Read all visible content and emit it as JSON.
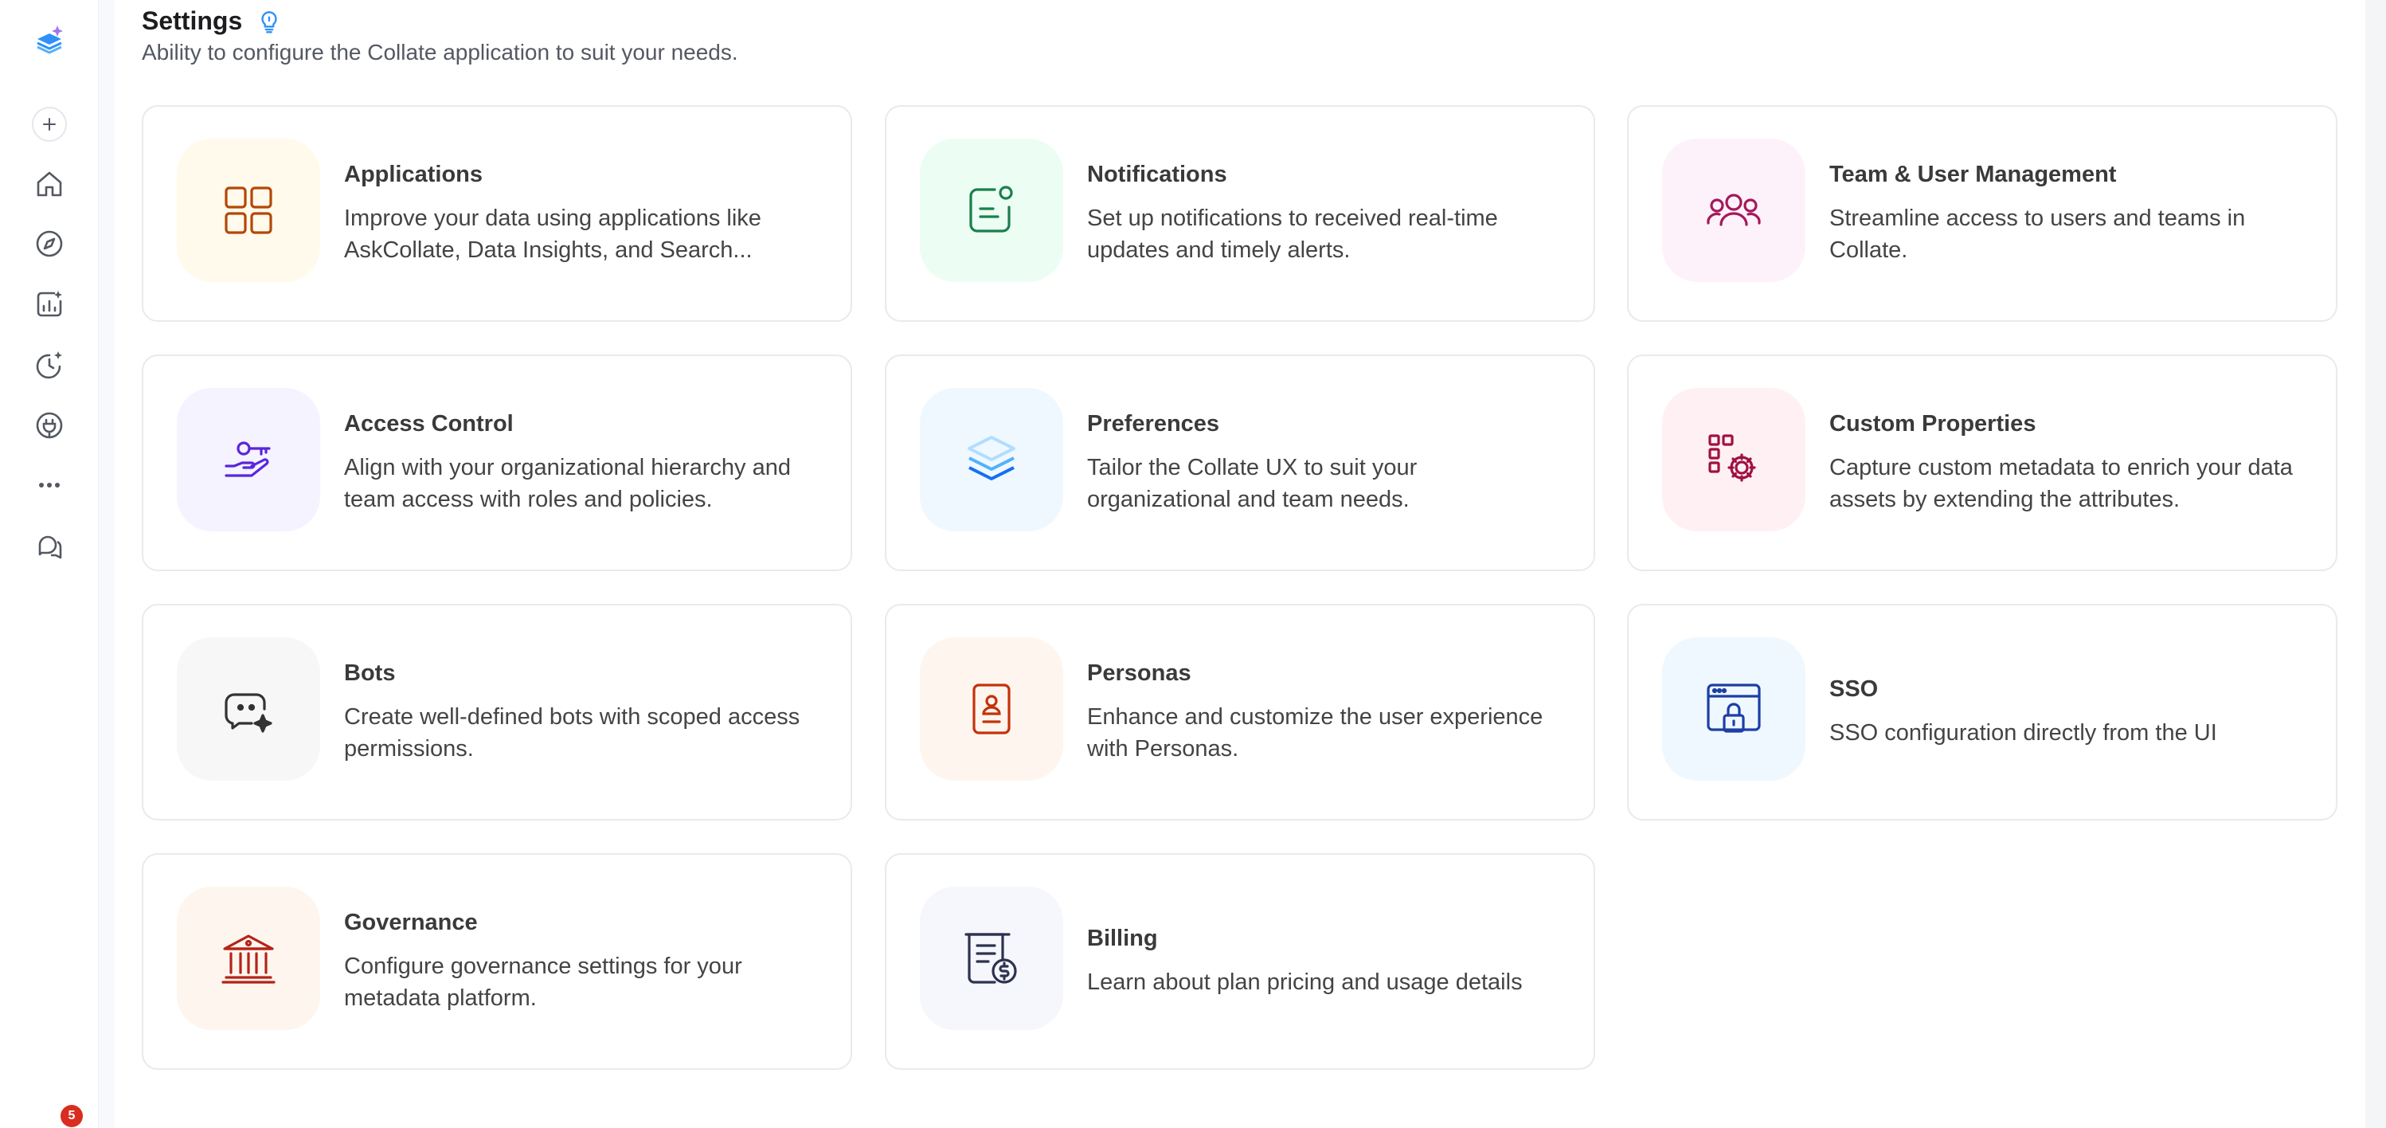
{
  "page": {
    "title": "Settings",
    "subtitle": "Ability to configure the Collate application to suit your needs."
  },
  "sidebar": {
    "badge_count": "5",
    "items": [
      "collate-logo-icon",
      "add-icon",
      "home-icon",
      "explore-icon",
      "insights-icon",
      "observability-icon",
      "governance-icon",
      "more-icon",
      "help-icon"
    ]
  },
  "cards": [
    {
      "title": "Applications",
      "description": "Improve your data using applications like AskCollate, Data Insights, and Search...",
      "icon": "applications-icon",
      "bg": "#fffaeb",
      "color": "#b54708"
    },
    {
      "title": "Notifications",
      "description": "Set up notifications to received real-time updates and timely alerts.",
      "icon": "notifications-icon",
      "bg": "#ecfdf3",
      "color": "#1a7f4b"
    },
    {
      "title": "Team & User Management",
      "description": "Streamline access to users and teams in Collate.",
      "icon": "team-icon",
      "bg": "#fdf2fa",
      "color": "#a5185b"
    },
    {
      "title": "Access Control",
      "description": "Align with your organizational hierarchy and team access with roles and policies.",
      "icon": "access-control-icon",
      "bg": "#f4f3ff",
      "color": "#5925dc"
    },
    {
      "title": "Preferences",
      "description": "Tailor the Collate UX to suit your organizational and team needs.",
      "icon": "preferences-icon",
      "bg": "#eff8ff",
      "color": "#2e90fa"
    },
    {
      "title": "Custom Properties",
      "description": "Capture custom metadata to enrich your data assets by extending the attributes.",
      "icon": "custom-properties-icon",
      "bg": "#fff1f3",
      "color": "#a11043"
    },
    {
      "title": "Bots",
      "description": "Create well-defined bots with scoped access permissions.",
      "icon": "bots-icon",
      "bg": "#f7f7f7",
      "color": "#333333"
    },
    {
      "title": "Personas",
      "description": "Enhance and customize the user experience with Personas.",
      "icon": "personas-icon",
      "bg": "#fef6ee",
      "color": "#c4320a"
    },
    {
      "title": "SSO",
      "description": "SSO configuration directly from the UI",
      "icon": "sso-icon",
      "bg": "#eff8ff",
      "color": "#1d3fa5"
    },
    {
      "title": "Governance",
      "description": "Configure governance settings for your metadata platform.",
      "icon": "governance-icon",
      "bg": "#fef6ee",
      "color": "#b42318"
    },
    {
      "title": "Billing",
      "description": "Learn about plan pricing and usage details",
      "icon": "billing-icon",
      "bg": "#f5f7fc",
      "color": "#2d3250"
    }
  ]
}
